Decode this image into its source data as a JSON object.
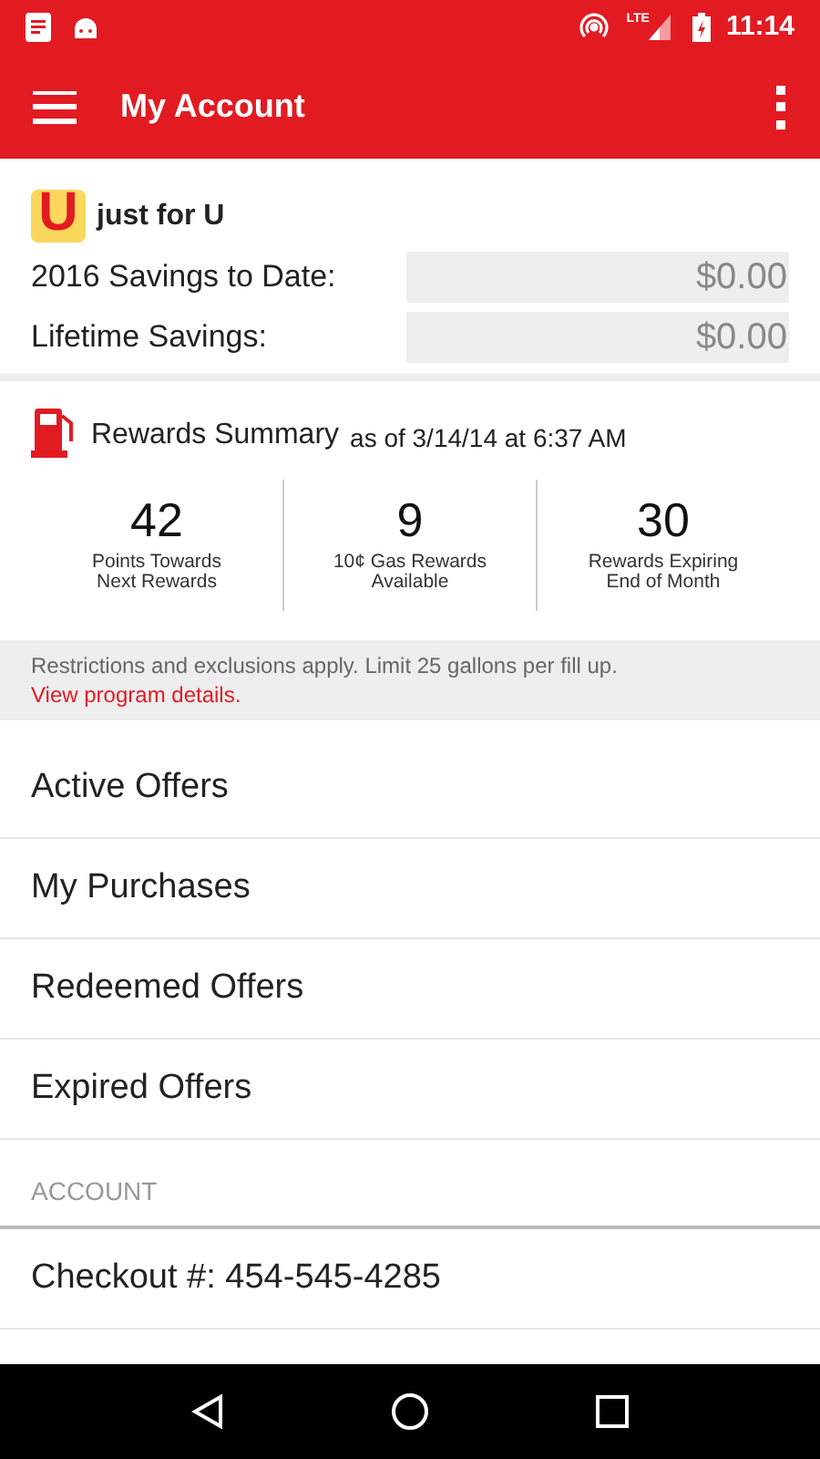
{
  "status_bar": {
    "time": "11:14",
    "network": "LTE"
  },
  "app_bar": {
    "title": "My Account"
  },
  "savings": {
    "logo_letter": "U",
    "program": "just for U",
    "rows": [
      {
        "label": "2016 Savings to Date:",
        "value": "$0.00"
      },
      {
        "label": "Lifetime Savings:",
        "value": "$0.00"
      }
    ]
  },
  "rewards": {
    "title": "Rewards Summary",
    "as_of": "as of 3/14/14 at 6:37 AM",
    "stats": [
      {
        "value": "42",
        "label": "Points Towards\nNext Rewards"
      },
      {
        "value": "9",
        "label": "10¢ Gas Rewards\nAvailable"
      },
      {
        "value": "30",
        "label": "Rewards Expiring\nEnd of Month"
      }
    ],
    "note": "Restrictions and exclusions apply. Limit 25 gallons per fill up.",
    "link": "View program details."
  },
  "menu_items": [
    "Active Offers",
    "My Purchases",
    "Redeemed Offers",
    "Expired Offers"
  ],
  "account": {
    "header": "ACCOUNT",
    "items": [
      "Checkout #: 454-545-4285"
    ]
  }
}
